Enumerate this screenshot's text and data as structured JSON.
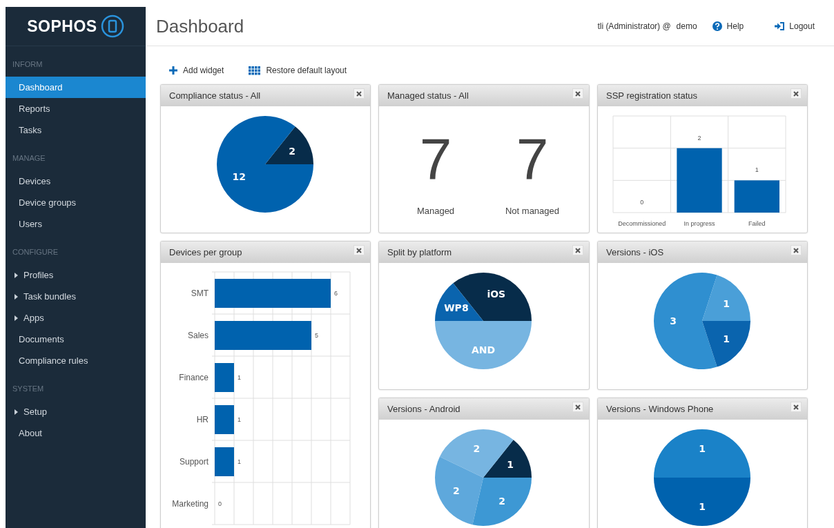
{
  "sidebar": {
    "logo": "SOPHOS",
    "sections": [
      {
        "heading": "INFORM",
        "items": [
          {
            "label": "Dashboard",
            "kind": "link",
            "selected": true
          },
          {
            "label": "Reports",
            "kind": "link",
            "selected": false
          },
          {
            "label": "Tasks",
            "kind": "link",
            "selected": false
          }
        ]
      },
      {
        "heading": "MANAGE",
        "items": [
          {
            "label": "Devices",
            "kind": "link",
            "selected": false
          },
          {
            "label": "Device groups",
            "kind": "link",
            "selected": false
          },
          {
            "label": "Users",
            "kind": "link",
            "selected": false
          }
        ]
      },
      {
        "heading": "CONFIGURE",
        "items": [
          {
            "label": "Profiles",
            "kind": "group",
            "selected": false
          },
          {
            "label": "Task bundles",
            "kind": "group",
            "selected": false
          },
          {
            "label": "Apps",
            "kind": "group",
            "selected": false
          },
          {
            "label": "Documents",
            "kind": "link",
            "selected": false
          },
          {
            "label": "Compliance rules",
            "kind": "link",
            "selected": false
          }
        ]
      },
      {
        "heading": "SYSTEM",
        "items": [
          {
            "label": "Setup",
            "kind": "group",
            "selected": false
          },
          {
            "label": "About",
            "kind": "link",
            "selected": false
          }
        ]
      }
    ]
  },
  "header": {
    "title": "Dashboard",
    "user": "tli (Administrator) @",
    "tenant": "demo",
    "links": [
      {
        "label": "Help",
        "kind": "help"
      },
      {
        "label": "Logout",
        "kind": "logout"
      }
    ]
  },
  "toolbar": [
    {
      "label": "Add widget",
      "kind": "add"
    },
    {
      "label": "Restore default layout",
      "kind": "restore"
    }
  ],
  "widgets": [
    {
      "title": "Compliance status - All",
      "kind": "chart",
      "chart_data": {
        "type": "pie",
        "values": [
          2,
          12
        ],
        "colors": [
          "#072c4a",
          "#0062ae"
        ],
        "data_labels": true
      }
    },
    {
      "title": "Managed status - All",
      "kind": "counts",
      "counts": [
        {
          "value": "7",
          "label": "Managed"
        },
        {
          "value": "7",
          "label": "Not managed"
        }
      ]
    },
    {
      "title": "SSP registration status",
      "kind": "chart",
      "chart_data": {
        "type": "bar",
        "orientation": "vertical",
        "categories": [
          "Decommissioned",
          "In progress",
          "Failed"
        ],
        "series": [
          {
            "color": "#0062ae",
            "values": [
              0,
              2,
              1
            ]
          }
        ],
        "data_labels": true
      }
    },
    {
      "title": "Devices per group",
      "kind": "chart",
      "chart_data": {
        "type": "bar",
        "orientation": "horizontal",
        "categories": [
          "SMT",
          "Sales",
          "Finance",
          "HR",
          "Support",
          "Marketing"
        ],
        "series": [
          {
            "color": "#0062ae",
            "values": [
              6,
              5,
              1,
              1,
              1,
              0
            ]
          }
        ],
        "data_labels": true
      }
    },
    {
      "title": "Split by platform",
      "kind": "chart",
      "chart_data": {
        "type": "pie",
        "categories": [
          "iOS",
          "WP8",
          "AND"
        ],
        "values": [
          35.71,
          14.29,
          50
        ],
        "colors": [
          "#072c4a",
          "#0a64ae",
          "#77b5e1"
        ],
        "data_labels": "categories"
      }
    },
    {
      "title": "Versions - iOS",
      "kind": "chart",
      "chart_data": {
        "type": "pie",
        "values": [
          1,
          3,
          1
        ],
        "colors": [
          "#4a9fd8",
          "#2f8fd0",
          "#0a64ae"
        ],
        "data_labels": true
      }
    },
    {
      "title": "Versions - Android",
      "kind": "chart",
      "chart_data": {
        "type": "pie",
        "values": [
          1,
          2,
          2,
          2
        ],
        "colors": [
          "#072c4a",
          "#77b5e1",
          "#5ea8dc",
          "#3d98d4"
        ],
        "data_labels": true
      }
    },
    {
      "title": "Versions - Windows Phone",
      "kind": "chart",
      "chart_data": {
        "type": "pie",
        "values": [
          1,
          1
        ],
        "colors": [
          "#1a82c8",
          "#0062ae"
        ],
        "data_labels": true
      }
    }
  ]
}
